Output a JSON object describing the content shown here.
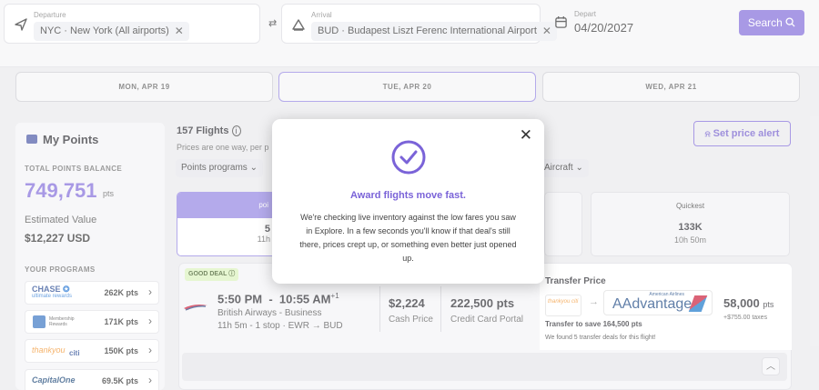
{
  "search_bar": {
    "departure_caption": "Departure",
    "departure_value": "NYC · New York (All airports)",
    "arrival_caption": "Arrival",
    "arrival_value": "BUD · Budapest Liszt Ferenc International Airport",
    "depart_caption": "Depart",
    "depart_date": "04/20/2027",
    "search_label": "Search",
    "remove_glyph": "✕",
    "swap_glyph": "⇄"
  },
  "day_tabs": [
    "MON, APR 19",
    "TUE, APR 20",
    "WED, APR 21"
  ],
  "points_panel": {
    "title": "My Points",
    "balance_label": "TOTAL POINTS BALANCE",
    "balance_value": "749,751",
    "balance_unit": "pts",
    "estimated_label": "Estimated Value",
    "estimated_value": "$12,227 USD",
    "programs_label": "YOUR PROGRAMS",
    "programs": [
      {
        "name": "Chase Ultimate Rewards",
        "logo_text": "CHASE",
        "logo_sub": "ultimate rewards",
        "points": "262K pts"
      },
      {
        "name": "Amex Membership Rewards",
        "logo_text": "Membership",
        "logo_sub": "Rewards",
        "points": "171K pts"
      },
      {
        "name": "Citi ThankYou",
        "logo_text": "thankyou",
        "logo_sub": "citi",
        "points": "150K pts"
      },
      {
        "name": "Capital One",
        "logo_text": "CapitalOne",
        "logo_sub": "",
        "points": "69.5K pts"
      }
    ]
  },
  "results": {
    "count_label": "157 Flights",
    "subtitle": "Prices are one way, per p",
    "filters": [
      "Points programs",
      "Aircraft"
    ],
    "set_alert_label": "Set price alert",
    "sort_cards": [
      {
        "title": "poi",
        "value": "5",
        "sub": "11h"
      },
      {
        "title": "Quickest",
        "value": "133K",
        "sub": "10h 50m"
      }
    ]
  },
  "flight": {
    "badge": "GOOD DEAL",
    "times": "5:50 PM  -  10:55 AM",
    "day_offset": "+1",
    "airline_cabin": "British Airways - Business",
    "details": "11h 5m - 1 stop · EWR → BUD",
    "cash_price": "$2,224",
    "cash_label": "Cash Price",
    "cc_points": "222,500 pts",
    "cc_label": "Credit Card Portal",
    "transfer_title": "Transfer Price",
    "from_logo": "thankyou citi",
    "to_logo_top": "American Airlines",
    "to_logo": "AAdvantage",
    "transfer_points": "58,000",
    "transfer_unit": "pts",
    "transfer_taxes": "+$755.00 taxes",
    "save_text": "Transfer to save 164,500 pts",
    "found_text": "We found 5 transfer deals for this flight!"
  },
  "modal": {
    "title": "Award flights move fast.",
    "body": "We're checking live inventory against the low fares you saw in Explore. In a few seconds you'll know if that deal's still there, prices crept up, or something even better just opened up.",
    "close_glyph": "✕"
  },
  "colors": {
    "accent": "#7a63d8",
    "green_badge": "#d9f2b8",
    "panel": "#f3f3f6"
  }
}
